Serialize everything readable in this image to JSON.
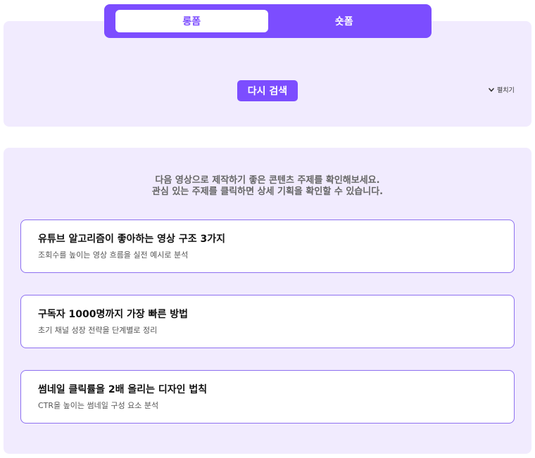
{
  "tabs": [
    {
      "label": "롱폼",
      "active": true
    },
    {
      "label": "숏폼",
      "active": false
    }
  ],
  "search": {
    "retry_label": "다시 검색",
    "expand_label": "펼치기"
  },
  "results": {
    "intro_line1": "다음 영상으로 제작하기 좋은 콘텐츠 주제를 확인해보세요.",
    "intro_line2": "관심 있는 주제를 클릭하면 상세 기획을 확인할 수 있습니다.",
    "topics": [
      {
        "title": "유튜브 알고리즘이 좋아하는 영상 구조 3가지",
        "description": "조회수를 높이는 영상 흐름을 실전 예시로 분석"
      },
      {
        "title": "구독자 1000명까지 가장 빠른 방법",
        "description": "초기 채널 성장 전략을 단계별로 정리"
      },
      {
        "title": "썸네일 클릭률을 2배 올리는 디자인 법칙",
        "description": "CTR을 높이는 썸네일 구성 요소 분석"
      }
    ]
  },
  "colors": {
    "accent": "#7c4dff",
    "panel_background": "#f1ebfe",
    "card_border": "#8d70f0"
  }
}
